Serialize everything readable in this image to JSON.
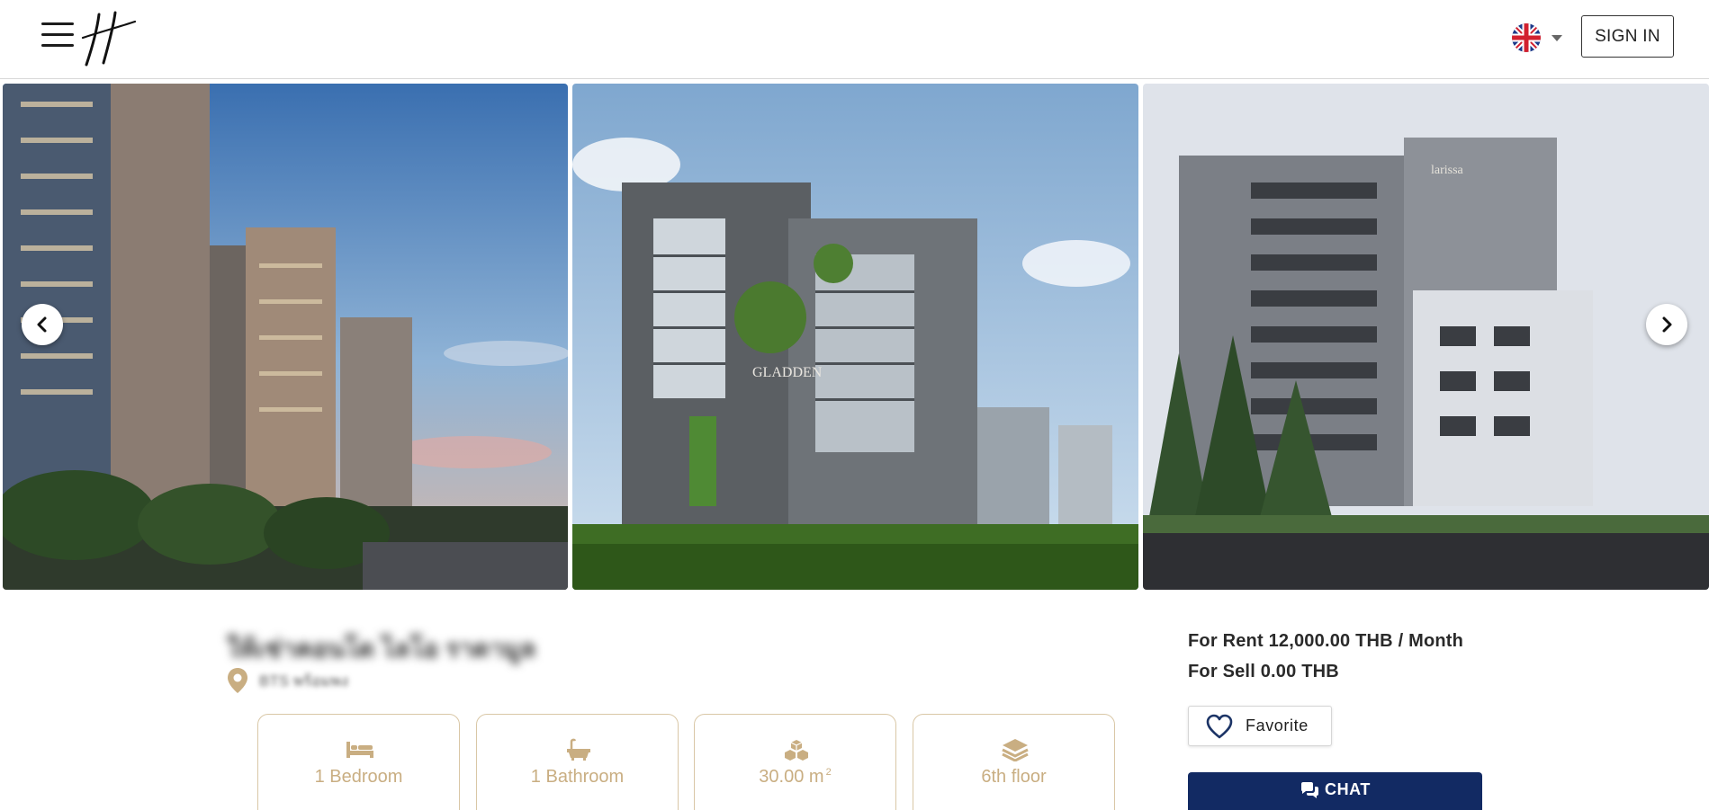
{
  "header": {
    "menu_icon": "hamburger-menu-icon",
    "logo_icon": "brand-logo-icon",
    "language_flag": "uk-flag-icon",
    "signin_label": "SIGN IN"
  },
  "gallery": {
    "photos": [
      {
        "name": "condo-building-photo-1"
      },
      {
        "name": "condo-building-photo-2",
        "sign_text": "GLADDEN"
      },
      {
        "name": "condo-building-photo-3",
        "sign_text": "larissa"
      }
    ],
    "prev_icon": "chevron-left-icon",
    "next_icon": "chevron-right-icon"
  },
  "listing": {
    "title": "ให้เช่าคอนโด ไลโอ ราดามูล",
    "location": "BTS พร้อมพง",
    "location_icon": "map-pin-icon",
    "features": [
      {
        "icon": "bed-icon",
        "label": "1 Bedroom"
      },
      {
        "icon": "bathtub-icon",
        "label": "1 Bathroom"
      },
      {
        "icon": "area-cubes-icon",
        "label": "30.00",
        "unit": "m",
        "unit_sup": "2"
      },
      {
        "icon": "floor-layers-icon",
        "label": "6th floor"
      }
    ],
    "feature_color": "#c9ae82"
  },
  "pricing": {
    "rent": "For Rent 12,000.00 THB / Month",
    "sell": "For Sell 0.00 THB"
  },
  "actions": {
    "favorite_label": "Favorite",
    "favorite_icon": "heart-outline-icon",
    "chat_label": "CHAT",
    "chat_icon": "chat-bubbles-icon",
    "chat_color": "#122a63"
  }
}
